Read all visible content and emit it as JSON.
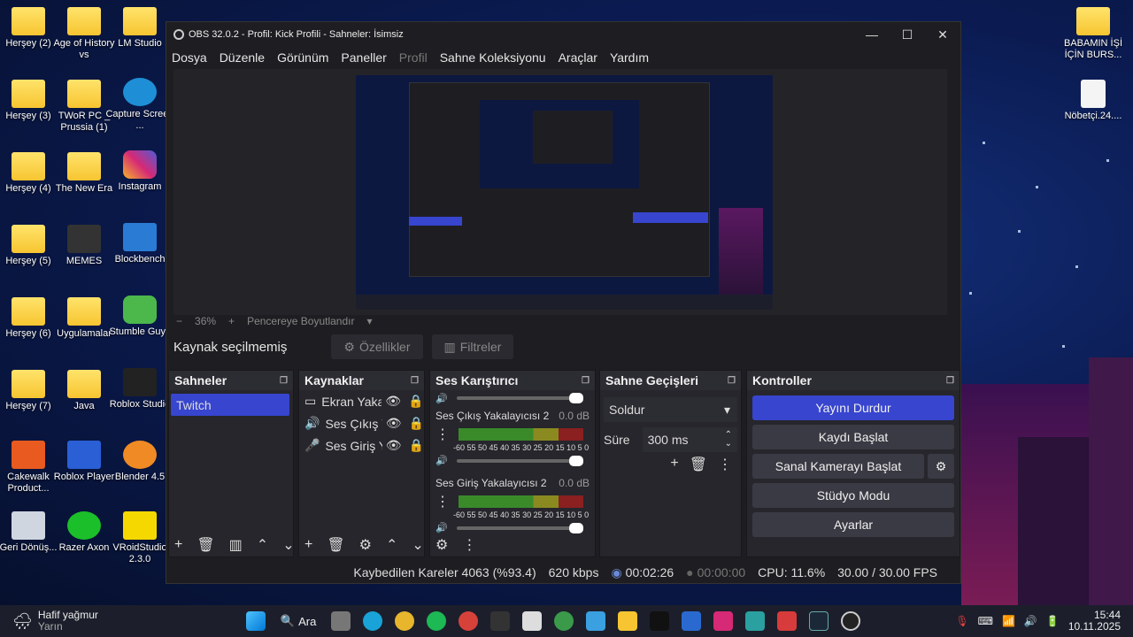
{
  "desktop_icons": [
    {
      "label": "Herşey (2)"
    },
    {
      "label": "Age of History vs"
    },
    {
      "label": "LM Studio"
    },
    {
      "label": "Herşey (3)"
    },
    {
      "label": "TWoR PC _ Prussia (1)"
    },
    {
      "label": "Capture Screen ..."
    },
    {
      "label": "Herşey (4)"
    },
    {
      "label": "The New Era"
    },
    {
      "label": "Instagram"
    },
    {
      "label": "Herşey (5)"
    },
    {
      "label": "MEMES"
    },
    {
      "label": "Blockbench"
    },
    {
      "label": "Herşey (6)"
    },
    {
      "label": "Uygulamalar"
    },
    {
      "label": "Stumble Guys"
    },
    {
      "label": "Herşey (7)"
    },
    {
      "label": "Java"
    },
    {
      "label": "Roblox Studio"
    },
    {
      "label": "Cakewalk Product..."
    },
    {
      "label": "Roblox Player"
    },
    {
      "label": "Blender 4.5"
    },
    {
      "label": "Geri Dönüş..."
    },
    {
      "label": "Razer Axon"
    },
    {
      "label": "VRoidStudio 2.3.0"
    },
    {
      "label": "BABAMIN İŞİ İÇİN BURS..."
    },
    {
      "label": "Nöbetçi.24...."
    }
  ],
  "window": {
    "title": "OBS 32.0.2 - Profil: Kick Profili - Sahneler: İsimsiz",
    "minimize": "—",
    "maximize": "☐",
    "close": "✕"
  },
  "menu": [
    "Dosya",
    "Düzenle",
    "Görünüm",
    "Paneller",
    "Profil",
    "Sahne Koleksiyonu",
    "Araçlar",
    "Yardım"
  ],
  "zoom": {
    "minus": "−",
    "value": "36%",
    "plus": "+",
    "fit": "Pencereye Boyutlandır",
    "caret": "▾"
  },
  "source_bar": {
    "label": "Kaynak seçilmemiş",
    "properties": "Özellikler",
    "filters": "Filtreler"
  },
  "scenes": {
    "title": "Sahneler",
    "items": [
      "Twitch"
    ]
  },
  "sources": {
    "title": "Kaynaklar",
    "items": [
      "Ekran Yaka",
      "Ses Çıkış Ya",
      "Ses Giriş Ya"
    ]
  },
  "mixer": {
    "title": "Ses Karıştırıcı",
    "channels": [
      {
        "name": "Ses Çıkış Yakalayıcısı 2",
        "db": "0.0 dB"
      },
      {
        "name": "Ses Giriş Yakalayıcısı 2",
        "db": "0.0 dB"
      }
    ],
    "scale": "-60 55 50 45 40 35 30 25 20 15 10 5 0"
  },
  "transitions": {
    "title": "Sahne Geçişleri",
    "selected": "Soldur",
    "duration_label": "Süre",
    "duration": "300 ms"
  },
  "controls": {
    "title": "Kontroller",
    "stop_stream": "Yayını Durdur",
    "start_record": "Kaydı Başlat",
    "virtual_cam": "Sanal Kamerayı Başlat",
    "studio": "Stüdyo Modu",
    "settings": "Ayarlar"
  },
  "status": {
    "dropped": "Kaybedilen Kareler 4063 (%93.4)",
    "bitrate": "620 kbps",
    "stream_time": "00:02:26",
    "rec_time": "00:00:00",
    "cpu": "CPU: 11.6%",
    "fps": "30.00 / 30.00 FPS"
  },
  "taskbar": {
    "weather": "Hafif yağmur",
    "weather_sub": "Yarın",
    "search": "Ara",
    "time": "15:44",
    "date": "10.11.2025"
  },
  "colors": {
    "accent": "#3745cf",
    "scene_sel": "#3745cf"
  }
}
